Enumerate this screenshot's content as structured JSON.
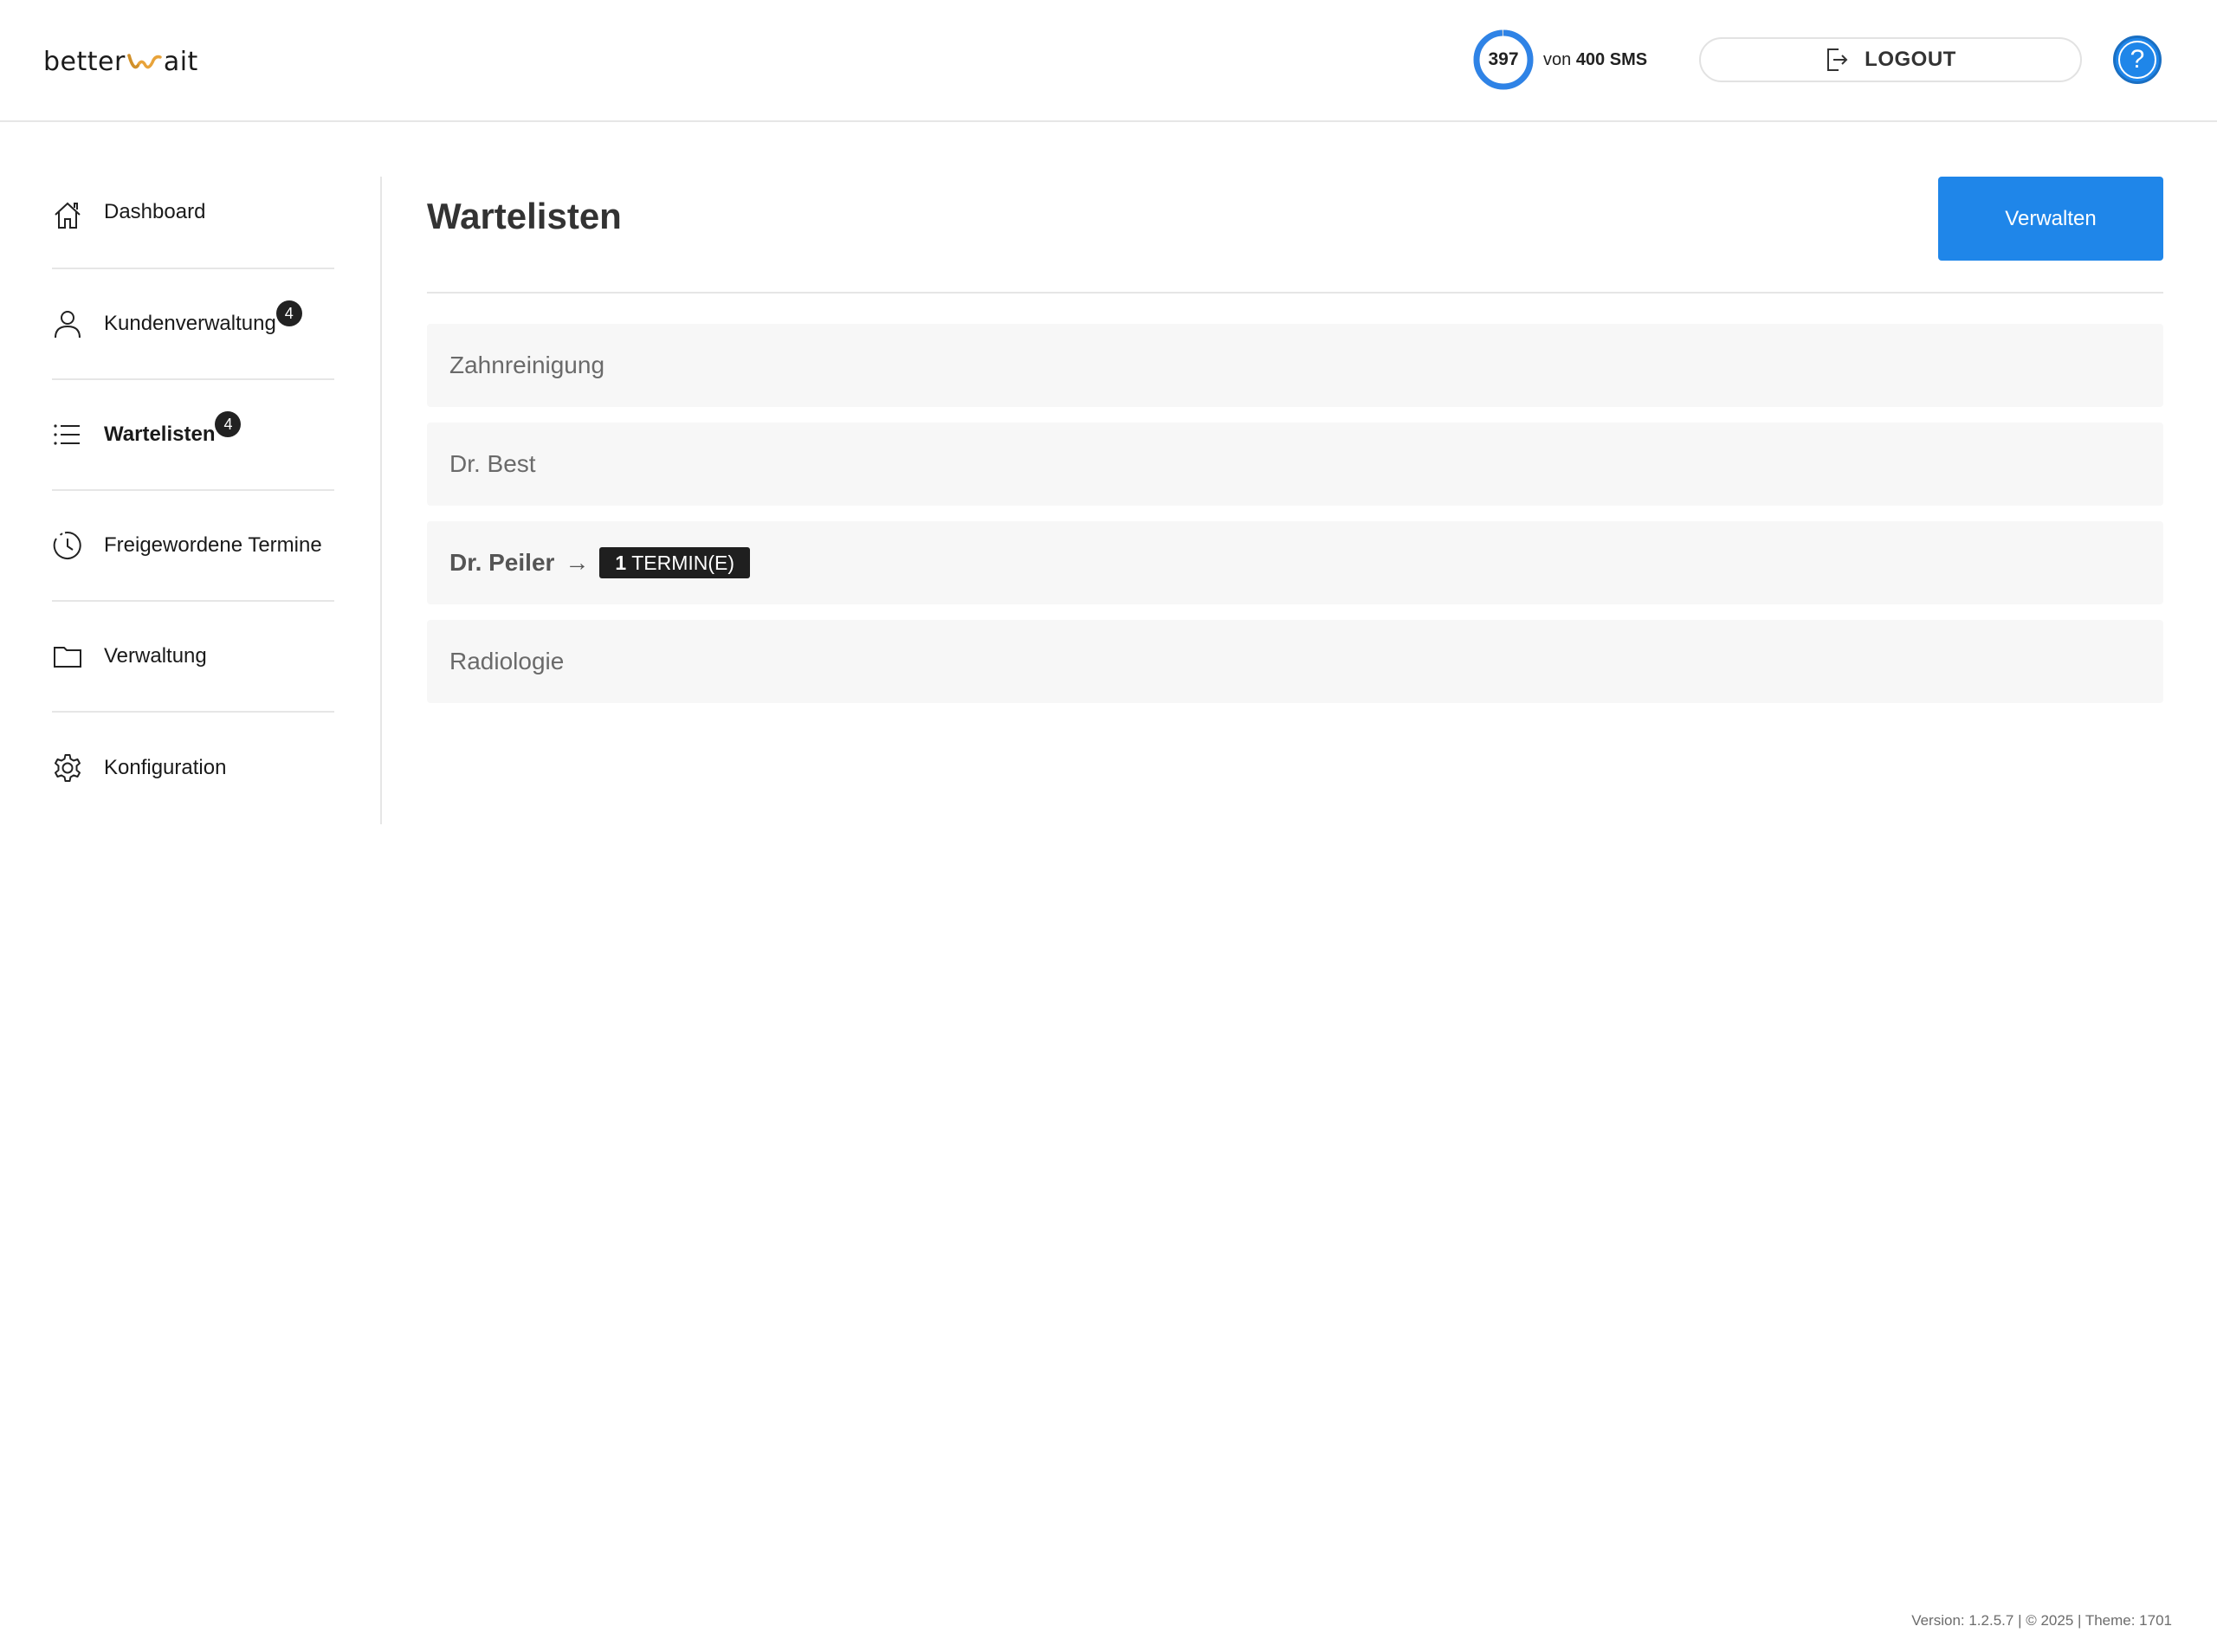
{
  "header": {
    "logo_left": "better",
    "logo_right": "ait",
    "sms": {
      "used": "397",
      "von": "von",
      "total_label": "400 SMS",
      "fraction": 0.9925
    },
    "logout_label": "LOGOUT",
    "help_glyph": "?"
  },
  "sidebar": {
    "items": [
      {
        "label": "Dashboard",
        "icon": "home-icon",
        "badge": ""
      },
      {
        "label": "Kundenverwaltung",
        "icon": "user-icon",
        "badge": "4"
      },
      {
        "label": "Wartelisten",
        "icon": "list-icon",
        "badge": "4",
        "active": true
      },
      {
        "label": "Freigewordene Termine",
        "icon": "clock-history-icon",
        "badge": ""
      },
      {
        "label": "Verwaltung",
        "icon": "folder-icon",
        "badge": ""
      },
      {
        "label": "Konfiguration",
        "icon": "gear-icon",
        "badge": ""
      }
    ]
  },
  "main": {
    "title": "Wartelisten",
    "manage_label": "Verwalten",
    "lists": [
      {
        "name": "Zahnreinigung"
      },
      {
        "name": "Dr. Best"
      },
      {
        "name": "Dr. Peiler",
        "arrow": "→",
        "termin_count": "1",
        "termin_label": "TERMIN(E)"
      },
      {
        "name": "Radiologie"
      }
    ]
  },
  "footer": {
    "text": "Version: 1.2.5.7 | © 2025 | Theme: 1701"
  },
  "colors": {
    "accent": "#1f86e9",
    "ring_orange": "#e8a33a"
  }
}
